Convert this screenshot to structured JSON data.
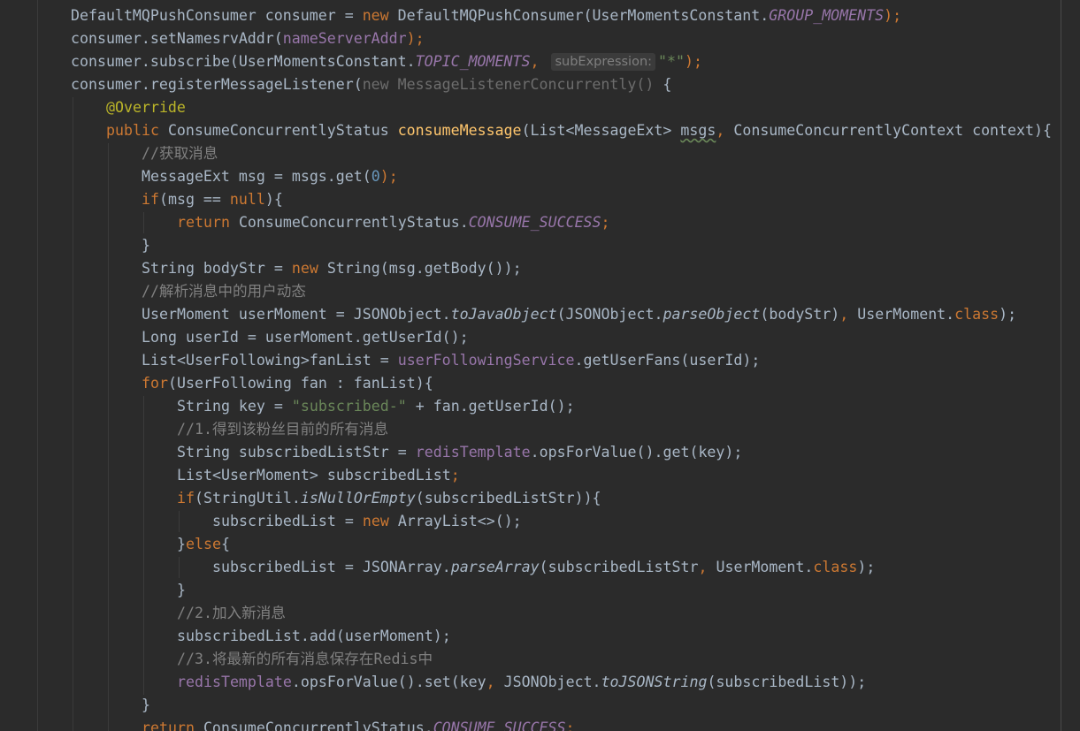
{
  "editor": {
    "inlay_hint": "subExpression:",
    "lines": [
      [
        {
          "t": "DefaultMQPushConsumer consumer = "
        },
        {
          "t": "new ",
          "c": "kw"
        },
        {
          "t": "DefaultMQPushConsumer(UserMomentsConstant."
        },
        {
          "t": "GROUP_MOMENTS",
          "c": "sfld"
        },
        {
          "t": ");",
          "c": "kw"
        }
      ],
      [
        {
          "t": "consumer.setNamesrvAddr("
        },
        {
          "t": "nameServerAddr",
          "c": "fld"
        },
        {
          "t": ");",
          "c": "kw"
        }
      ],
      [
        {
          "t": "consumer.subscribe(UserMomentsConstant."
        },
        {
          "t": "TOPIC_MOMENTS",
          "c": "sfld"
        },
        {
          "t": ", ",
          "c": "kw"
        },
        {
          "hint": true
        },
        {
          "t": "\"*\"",
          "c": "str"
        },
        {
          "t": ");",
          "c": "kw"
        }
      ],
      [
        {
          "t": "consumer.registerMessageListener("
        },
        {
          "t": "new MessageListenerConcurrently()",
          "c": "dim"
        },
        {
          "t": " {"
        }
      ],
      [
        {
          "t": "@Override",
          "c": "ann"
        }
      ],
      [
        {
          "t": "public ",
          "c": "kw"
        },
        {
          "t": "ConsumeConcurrentlyStatus "
        },
        {
          "t": "consumeMessage",
          "c": "meth"
        },
        {
          "t": "(List<MessageExt> "
        },
        {
          "t": "msgs",
          "c": "wavy"
        },
        {
          "t": ", ",
          "c": "kw"
        },
        {
          "t": "ConsumeConcurrentlyContext context){"
        }
      ],
      [
        {
          "t": "//获取消息",
          "c": "cmt"
        }
      ],
      [
        {
          "t": "MessageExt msg = msgs.get("
        },
        {
          "t": "0",
          "c": "num"
        },
        {
          "t": ");",
          "c": "kw"
        }
      ],
      [
        {
          "t": "if",
          "c": "kw"
        },
        {
          "t": "(msg == "
        },
        {
          "t": "null",
          "c": "kw"
        },
        {
          "t": "){"
        }
      ],
      [
        {
          "t": "return ",
          "c": "kw"
        },
        {
          "t": "ConsumeConcurrentlyStatus."
        },
        {
          "t": "CONSUME_SUCCESS",
          "c": "sfld"
        },
        {
          "t": ";",
          "c": "kw"
        }
      ],
      [
        {
          "t": "}"
        }
      ],
      [
        {
          "t": "String bodyStr = "
        },
        {
          "t": "new ",
          "c": "kw"
        },
        {
          "t": "String(msg.getBody());"
        }
      ],
      [
        {
          "t": "//解析消息中的用户动态",
          "c": "cmt"
        }
      ],
      [
        {
          "t": "UserMoment userMoment = JSONObject."
        },
        {
          "t": "toJavaObject",
          "c": "smeth"
        },
        {
          "t": "(JSONObject."
        },
        {
          "t": "parseObject",
          "c": "smeth"
        },
        {
          "t": "(bodyStr)"
        },
        {
          "t": ", ",
          "c": "kw"
        },
        {
          "t": "UserMoment."
        },
        {
          "t": "class",
          "c": "kw"
        },
        {
          "t": ");"
        }
      ],
      [
        {
          "t": "Long userId = userMoment.getUserId();"
        }
      ],
      [
        {
          "t": "List<UserFollowing>fanList = "
        },
        {
          "t": "userFollowingService",
          "c": "fld"
        },
        {
          "t": ".getUserFans(userId);"
        }
      ],
      [
        {
          "t": "for",
          "c": "kw"
        },
        {
          "t": "(UserFollowing fan : fanList){"
        }
      ],
      [
        {
          "t": "String key = "
        },
        {
          "t": "\"subscribed-\"",
          "c": "str"
        },
        {
          "t": " + fan.getUserId();"
        }
      ],
      [
        {
          "t": "//1.得到该粉丝目前的所有消息",
          "c": "cmt"
        }
      ],
      [
        {
          "t": "String subscribedListStr = "
        },
        {
          "t": "redisTemplate",
          "c": "fld"
        },
        {
          "t": ".opsForValue().get(key);"
        }
      ],
      [
        {
          "t": "List<UserMoment> subscribedList"
        },
        {
          "t": ";",
          "c": "kw"
        }
      ],
      [
        {
          "t": "if",
          "c": "kw"
        },
        {
          "t": "(StringUtil."
        },
        {
          "t": "isNullOrEmpty",
          "c": "smeth"
        },
        {
          "t": "(subscribedListStr)){"
        }
      ],
      [
        {
          "t": "subscribedList = "
        },
        {
          "t": "new ",
          "c": "kw"
        },
        {
          "t": "ArrayList<>();"
        }
      ],
      [
        {
          "t": "}"
        },
        {
          "t": "else",
          "c": "kw"
        },
        {
          "t": "{"
        }
      ],
      [
        {
          "t": "subscribedList = JSONArray."
        },
        {
          "t": "parseArray",
          "c": "smeth"
        },
        {
          "t": "(subscribedListStr"
        },
        {
          "t": ", ",
          "c": "kw"
        },
        {
          "t": "UserMoment."
        },
        {
          "t": "class",
          "c": "kw"
        },
        {
          "t": ");"
        }
      ],
      [
        {
          "t": "}"
        }
      ],
      [
        {
          "t": "//2.加入新消息",
          "c": "cmt"
        }
      ],
      [
        {
          "t": "subscribedList.add(userMoment);"
        }
      ],
      [
        {
          "t": "//3.将最新的所有消息保存在Redis中",
          "c": "cmt"
        }
      ],
      [
        {
          "t": "redisTemplate",
          "c": "fld"
        },
        {
          "t": ".opsForValue().set(key"
        },
        {
          "t": ", ",
          "c": "kw"
        },
        {
          "t": "JSONObject."
        },
        {
          "t": "toJSONString",
          "c": "smeth"
        },
        {
          "t": "(subscribedList));"
        }
      ],
      [
        {
          "t": "}"
        }
      ],
      [
        {
          "t": "return ",
          "c": "kw"
        },
        {
          "t": "ConsumeConcurrentlyStatus."
        },
        {
          "t": "CONSUME_SUCCESS",
          "c": "sfld"
        },
        {
          "t": ";",
          "c": "kw"
        }
      ]
    ]
  }
}
